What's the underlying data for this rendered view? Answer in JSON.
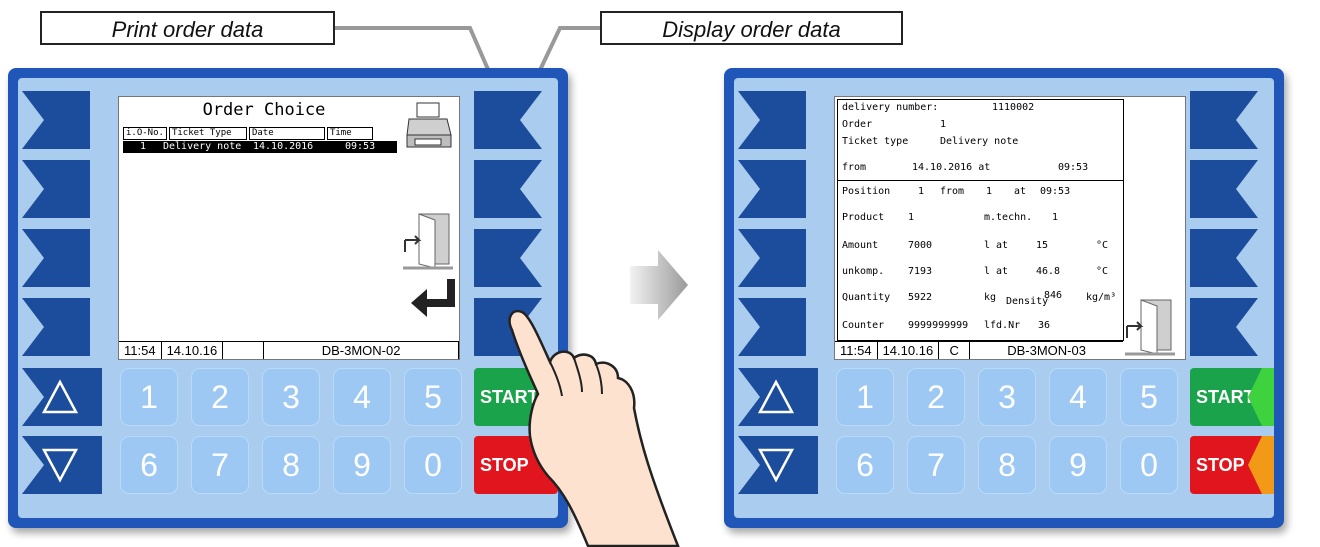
{
  "callouts": {
    "print": "Print order data",
    "display": "Display order data"
  },
  "left_screen": {
    "title": "Order Choice",
    "columns": [
      "i.O-No.",
      "Ticket Type",
      "Date",
      "Time"
    ],
    "selected_row": {
      "no": "1",
      "ticket_type": "Delivery note",
      "date": "14.10.2016",
      "time": "09:53"
    },
    "status": {
      "time": "11:54",
      "date": "14.10.16",
      "mode": "",
      "device": "DB-3MON-02"
    },
    "icons": [
      "printer-icon",
      "exit-door-icon",
      "enter-return-icon"
    ]
  },
  "right_screen": {
    "header": {
      "delivery_number_label": "delivery number:",
      "delivery_number": "1110002",
      "order_label": "Order",
      "order_value": "1",
      "ticket_type_label": "Ticket type",
      "ticket_type_value": "Delivery note",
      "from_label": "from",
      "from_date": "14.10.2016 at",
      "from_time": "09:53"
    },
    "rows": {
      "position_label": "Position",
      "position_value": "1",
      "position_from": "from",
      "position_from_value": "1",
      "position_at": "at",
      "position_time": "09:53",
      "product_label": "Product",
      "product_value": "1",
      "mtechn_label": "m.techn.",
      "mtechn_value": "1",
      "amount_label": "Amount",
      "amount_value": "7000",
      "amount_unit": "l at",
      "amount_temp": "15",
      "amount_temp_unit": "°C",
      "unkomp_label": "unkomp.",
      "unkomp_value": "7193",
      "unkomp_unit": "l at",
      "unkomp_temp": "46.8",
      "unkomp_temp_unit": "°C",
      "quantity_label": "Quantity",
      "quantity_value": "5922",
      "quantity_unit": "kg",
      "density_label": "Density",
      "density_value": "846",
      "density_unit": "kg/m³",
      "counter_label": "Counter",
      "counter_value": "9999999999",
      "lfd_label": "lfd.Nr",
      "lfd_value": "36"
    },
    "status": {
      "time": "11:54",
      "date": "14.10.16",
      "mode": "C",
      "device": "DB-3MON-03"
    },
    "icons": [
      "exit-door-icon"
    ]
  },
  "keypad": {
    "row1": [
      "1",
      "2",
      "3",
      "4",
      "5"
    ],
    "row2": [
      "6",
      "7",
      "8",
      "9",
      "0"
    ],
    "start_label": "START",
    "stop_label": "STOP"
  },
  "colors": {
    "frame": "#1f56b8",
    "panel": "#a9ccef",
    "softkey": "#1c4c9c",
    "key": "#9cc8f3",
    "start": "#1aa34a",
    "stop": "#e0151d",
    "start_tag": "#3fd23f",
    "stop_tag": "#f29a17"
  }
}
